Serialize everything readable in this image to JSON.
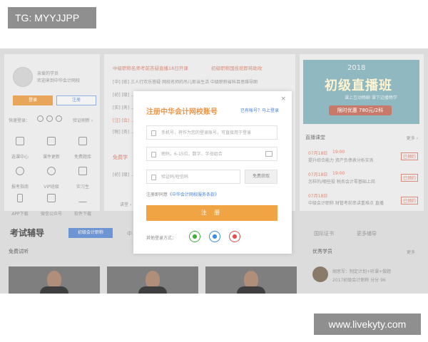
{
  "watermarks": {
    "top": "TG: MYYJJPP",
    "bottom": "www.livekyty.com"
  },
  "left_panel": {
    "welcome_line1": "亲爱的学员",
    "welcome_line2": "欢迎来到中华会计网校",
    "login_label": "登录",
    "register_label": "注册",
    "quick_login": "快速登录：",
    "refresh_label": "验证刷新 ›",
    "grid": [
      {
        "label": "选课中心"
      },
      {
        "label": "课件更新"
      },
      {
        "label": "免费题库"
      },
      {
        "label": "报考指南"
      },
      {
        "label": "VIP班级"
      },
      {
        "label": "实习生"
      },
      {
        "label": "APP下载"
      },
      {
        "label": "微信公众号"
      },
      {
        "label": "软件下载"
      }
    ]
  },
  "center_panel": {
    "headline1": "中级职称名师考前答疑直播18日开课",
    "headline2": "初级职称国技班即将助攻",
    "lines": [
      "[中]  [练]  三人行欢乐答疑 网校名师的吊儿郎当生活  中级职称省科目思维导图",
      "[初]  [级]  ………………………………………………………………",
      "[实]  [务]  ………………………………………………………………",
      "[注]  [会]  ………………………………………………………………",
      "[税]  [务]  ………………………………………………………………",
      "[初]  [级]  ………………………………………………………………"
    ],
    "free_label": "免费学",
    "more_label": "讲堂 ›"
  },
  "banner": {
    "year": "2018",
    "title": "初级直播班",
    "subtitle": "课上互动畅聊  课下边播畅学",
    "price": "限时优惠  780元/2科"
  },
  "live": {
    "title": "直播课堂",
    "more": "更多 ›",
    "items": [
      {
        "date": "07月18日",
        "time": "19:00",
        "text": "提升综合能力 资产负债表分析实务",
        "tag": "已预约"
      },
      {
        "date": "07月18日",
        "time": "19:00",
        "text": "怎样的/哪些投 税务会计零基础上岗",
        "tag": "已预约"
      },
      {
        "date": "07月18日",
        "time": "19:00",
        "text": "中级会计职称 财管考前串讲重难点 直播",
        "tag": "已预约"
      }
    ]
  },
  "bottom": {
    "section_title": "考试辅导",
    "badge": "初级会计职称",
    "tab_mid": "中",
    "tabs_right": [
      "国际证书",
      "更多辅导"
    ],
    "free_trial": "免费试听",
    "excellent": "优秀学员",
    "more": "更多",
    "student_name": "胡思军：制定计划+听课+做题",
    "student_sub": "2017初级会计职称 分分 96"
  },
  "modal": {
    "title": "注册中华会计网校账号",
    "has_account": "已有帐号？马上登录",
    "close": "×",
    "phone_placeholder": "手机号，将作为您的登录账号，可直接用于登录",
    "password_placeholder": "密码，6-15位，数字、字母组合",
    "code_placeholder": "验证码/短信码",
    "get_code": "免费获取",
    "agree_prefix": "注册即同意",
    "agree_link": "《中华会计网校服务条款》",
    "submit": "注 册",
    "other_login": "其他登录方式："
  },
  "colors": {
    "accent": "#f0a444",
    "link": "#4a80d8",
    "wechat": "#3fae3f",
    "qq": "#3a8ee0",
    "weibo": "#e05050"
  }
}
